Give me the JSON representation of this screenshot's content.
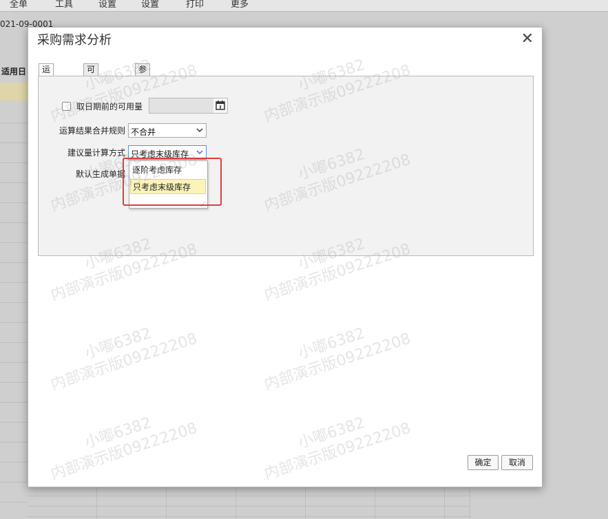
{
  "background": {
    "menus": [
      "全单",
      "工具",
      "设置",
      "设置",
      "打印",
      "更多"
    ],
    "doc_no": "021-09-0001",
    "column_label": "适用日"
  },
  "dialog": {
    "title": "采购需求分析",
    "close_glyph": "✕",
    "tabs": [
      {
        "label": "运算选项",
        "active": true
      },
      {
        "label": "可用量参数",
        "active": false
      },
      {
        "label": "参与运算的仓库",
        "active": false
      }
    ],
    "form": {
      "date_checkbox_label": "取日期前的可用量",
      "date_checked": false,
      "date_value": "",
      "merge_rule_label": "运算结果合并规则",
      "merge_rule_value": "不合并",
      "calc_method_label": "建议量计算方式",
      "calc_method_value": "只考虑末级库存",
      "default_doc_label": "默认生成单据",
      "calc_method_options": [
        {
          "label": "逐阶考虑库存",
          "selected": false
        },
        {
          "label": "只考虑末级库存",
          "selected": true
        }
      ]
    },
    "buttons": {
      "ok": "确定",
      "cancel": "取消"
    }
  },
  "watermark": {
    "line1": "小嘟6382",
    "line2": "内部演示版09222208"
  },
  "colors": {
    "highlight_border": "#e23b3b",
    "selected_option_bg": "#fbf3b8"
  }
}
